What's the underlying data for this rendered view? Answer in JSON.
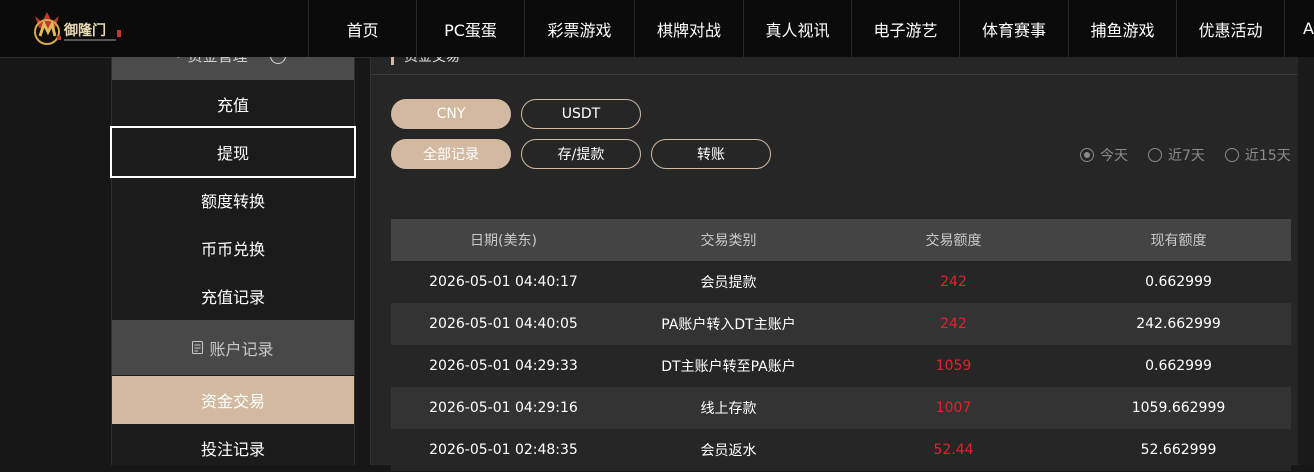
{
  "brand": {
    "logo_text": "御隆门",
    "accent": "#d2b9a0",
    "amount_color": "#e8202a"
  },
  "nav": {
    "items": [
      {
        "label": "首页",
        "key": "home"
      },
      {
        "label": "PC蛋蛋",
        "key": "pc-dandan"
      },
      {
        "label": "彩票游戏",
        "key": "lottery"
      },
      {
        "label": "棋牌对战",
        "key": "chess-cards"
      },
      {
        "label": "真人视讯",
        "key": "live-casino"
      },
      {
        "label": "电子游艺",
        "key": "slots"
      },
      {
        "label": "体育赛事",
        "key": "sports"
      },
      {
        "label": "捕鱼游戏",
        "key": "fishing"
      },
      {
        "label": "优惠活动",
        "key": "promotions"
      },
      {
        "label": "A",
        "key": "cut-off-item"
      }
    ]
  },
  "sidebar": {
    "items": [
      {
        "label": "充值",
        "key": "deposit"
      },
      {
        "label": "提现",
        "key": "withdraw"
      },
      {
        "label": "额度转换",
        "key": "quota-transfer"
      },
      {
        "label": "币币兑换",
        "key": "coin-exchange"
      },
      {
        "label": "充值记录",
        "key": "deposit-records"
      }
    ],
    "section_header": "账户记录",
    "sub_items": [
      {
        "label": "资金交易",
        "key": "fund-transactions"
      },
      {
        "label": "投注记录",
        "key": "bet-records"
      }
    ]
  },
  "currency_tabs": [
    "CNY",
    "USDT"
  ],
  "record_tabs": [
    "全部记录",
    "存/提款",
    "转账"
  ],
  "date_filters": [
    {
      "label": "今天",
      "checked": true
    },
    {
      "label": "近7天",
      "checked": false
    },
    {
      "label": "近15天",
      "checked": false
    }
  ],
  "table": {
    "headers": [
      "日期(美东)",
      "交易类别",
      "交易额度",
      "现有额度"
    ],
    "rows": [
      [
        "2026-05-01 04:40:17",
        "会员提款",
        "242",
        "0.662999"
      ],
      [
        "2026-05-01 04:40:05",
        "PA账户转入DT主账户",
        "242",
        "242.662999"
      ],
      [
        "2026-05-01 04:29:33",
        "DT主账户转至PA账户",
        "1059",
        "0.662999"
      ],
      [
        "2026-05-01 04:29:16",
        "线上存款",
        "1007",
        "1059.662999"
      ],
      [
        "2026-05-01 02:48:35",
        "会员返水",
        "52.44",
        "52.662999"
      ]
    ]
  }
}
